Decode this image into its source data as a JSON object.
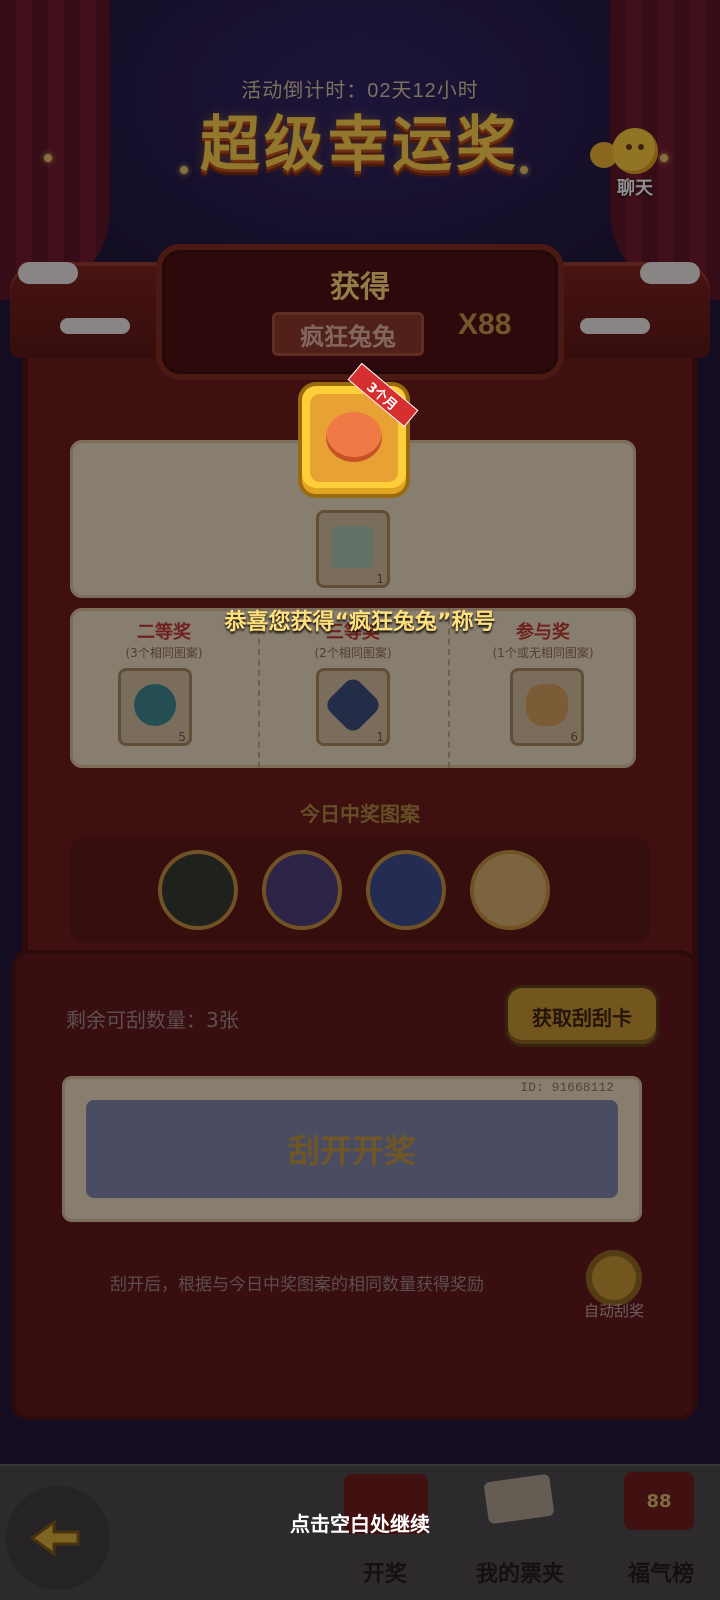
{
  "header": {
    "countdown": "活动倒计时：02天12小时",
    "title": "超级幸运奖",
    "chat_label": "聊天"
  },
  "prize_plaque": {
    "title": "获得",
    "prize_name": "疯狂兔兔",
    "prize_count": "X88"
  },
  "reward_popup": {
    "duration_badge": "3个月",
    "congrats_text": "恭喜您获得“疯狂兔兔”称号"
  },
  "prize_tiers": [
    {
      "name": "二等奖",
      "desc": "(3个相同图案)",
      "count": "5",
      "color": "#3a8a8f"
    },
    {
      "name": "三等奖",
      "desc": "(2个相同图案)",
      "count": "1",
      "color": "#3a4f7a"
    },
    {
      "name": "参与奖",
      "desc": "(1个或无相同图案)",
      "count": "6",
      "color": "#d9a35c"
    }
  ],
  "top_item_count": "1",
  "today": {
    "title": "今日中奖图案"
  },
  "scratch": {
    "remain_text": "剩余可刮数量：3张",
    "get_card_button": "获取刮刮卡",
    "ticket_id": "ID: 91668112",
    "scratch_label": "刮开开奖",
    "rule_text": "刮开后，根据与今日中奖图案的相同数量获得奖励",
    "auto_label": "自动刮奖"
  },
  "tabbar": {
    "tab_draw": "开奖",
    "tab_tickets": "我的票夹",
    "tab_ranking": "福气榜",
    "ranking_badge": "88"
  },
  "continue_text": "点击空白处继续",
  "colors": {
    "accent_gold": "#ffd84a",
    "cabinet_red": "#6b1a14",
    "panel_cream": "#efe2c3"
  }
}
